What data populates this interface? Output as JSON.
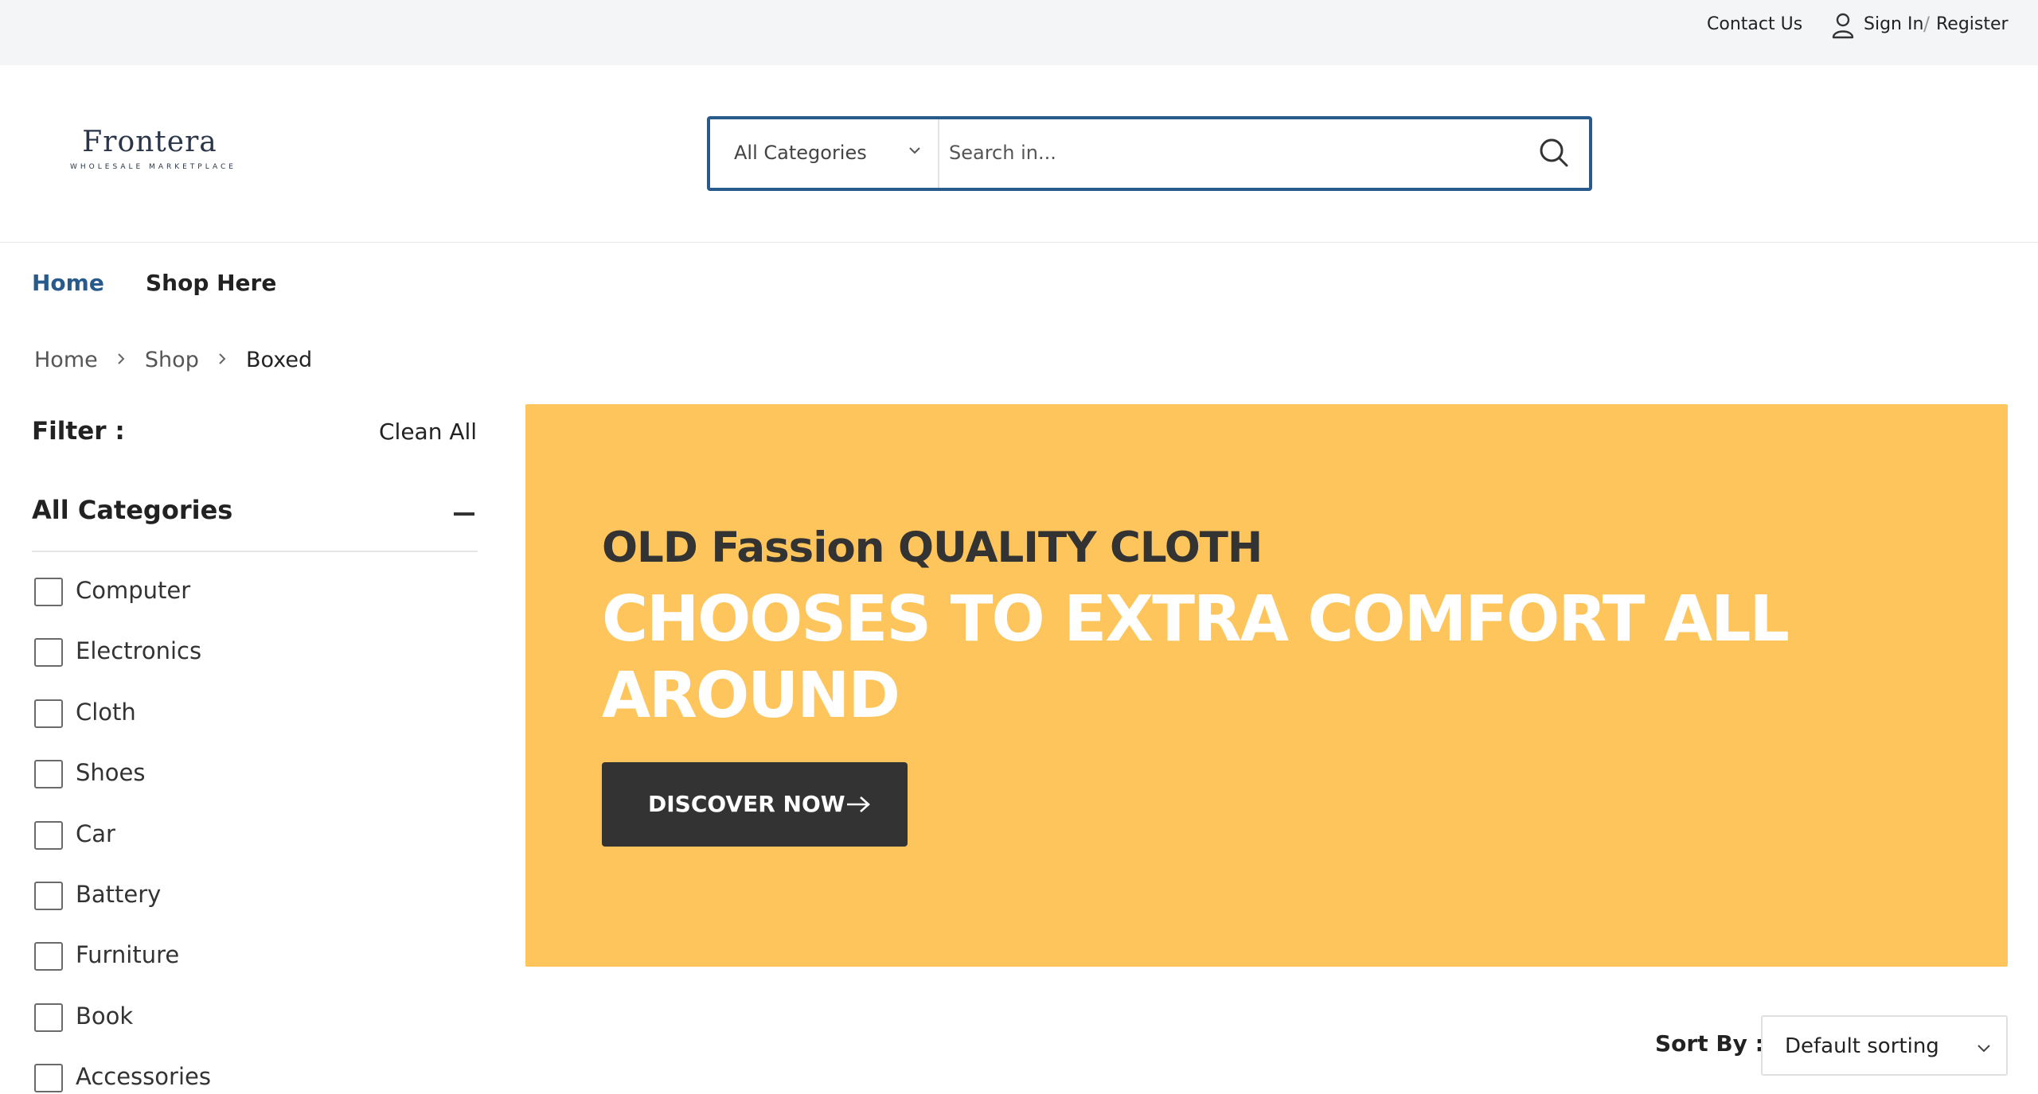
{
  "topbar": {
    "contact_label": "Contact Us",
    "signin_label": "Sign In",
    "separator": "/",
    "register_label": "Register"
  },
  "header": {
    "logo_brand": "Frontera",
    "logo_tagline": "WHOLESALE MARKETPLACE",
    "search": {
      "category_label": "All Categories",
      "placeholder": "Search in..."
    }
  },
  "nav": {
    "items": [
      {
        "label": "Home"
      },
      {
        "label": "Shop Here"
      }
    ]
  },
  "breadcrumb": [
    "Home",
    "Shop",
    "Boxed"
  ],
  "filter": {
    "title": "Filter :",
    "clear_label": "Clean All",
    "category_heading": "All Categories",
    "categories": [
      "Computer",
      "Electronics",
      "Cloth",
      "Shoes",
      "Car",
      "Battery",
      "Furniture",
      "Book",
      "Accessories"
    ]
  },
  "banner": {
    "subtitle": "OLD Fassion QUALITY CLOTH",
    "headline": "CHOOSES TO EXTRA COMFORT ALL AROUND",
    "cta_label": "DISCOVER NOW"
  },
  "sort": {
    "label": "Sort By :",
    "value": "Default sorting"
  },
  "colors": {
    "accent": "#285a8c",
    "banner_bg": "#fdc55b",
    "cta_bg": "#333333",
    "topbar_bg": "#f4f5f7"
  },
  "icons": {
    "user": "user-icon",
    "search": "search-icon",
    "dropdown": "chevron-down-icon",
    "breadcrumb_sep": "chevron-right-icon",
    "collapse": "minus-icon",
    "cta": "arrow-right-icon"
  }
}
